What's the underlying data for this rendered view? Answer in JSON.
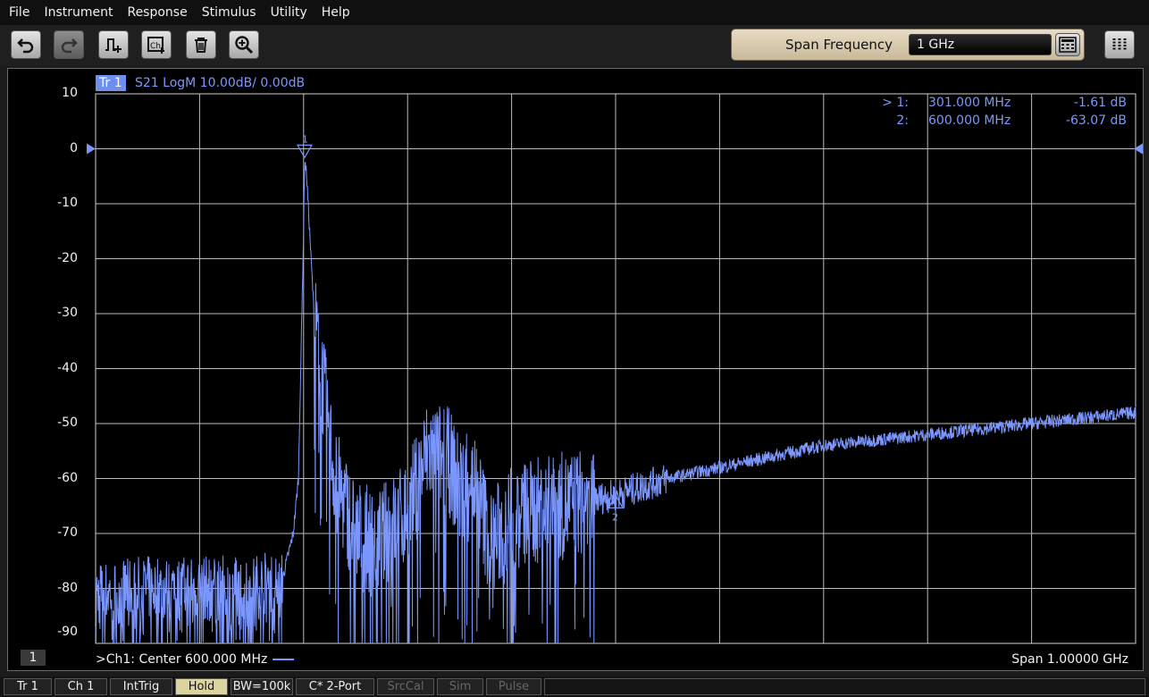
{
  "menu": [
    "File",
    "Instrument",
    "Response",
    "Stimulus",
    "Utility",
    "Help"
  ],
  "toolbar": {
    "icons": [
      "undo-icon",
      "redo-icon",
      "marker-add-icon",
      "channel-icon",
      "trash-icon",
      "zoom-in-icon"
    ],
    "ch_icon_text": "Ch",
    "span_label": "Span Frequency",
    "span_value": "1 GHz"
  },
  "trace": {
    "tag": "Tr 1",
    "info": "S21 LogM 10.00dB/  0.00dB",
    "color": "#7b97ff"
  },
  "markers": [
    {
      "label": "> 1:",
      "freq": "301.000  MHz",
      "value": "-1.61 dB",
      "id": "1"
    },
    {
      "label": "2:",
      "freq": "600.000  MHz",
      "value": "-63.07 dB",
      "id": "2"
    }
  ],
  "channel": {
    "indicator": "1",
    "center": ">Ch1:  Center  600.000 MHz",
    "span": "Span  1.00000 GHz"
  },
  "status": [
    "Tr 1",
    "Ch 1",
    "IntTrig",
    "Hold",
    "BW=100k",
    "C* 2-Port",
    "SrcCal",
    "Sim",
    "Pulse"
  ],
  "chart_data": {
    "type": "line",
    "title": "",
    "xlabel": "",
    "ylabel": "",
    "xlim": [
      100,
      1100
    ],
    "ylim": [
      -92,
      10
    ],
    "yticks": [
      10,
      0,
      -10,
      -20,
      -30,
      -40,
      -50,
      -60,
      -70,
      -80,
      -90
    ],
    "reference_level": 0,
    "grid": true,
    "series": [
      {
        "x": [
          100,
          150,
          200,
          250,
          280,
          290,
          295,
          300,
          301,
          303,
          310,
          320,
          330,
          350,
          370,
          400,
          420,
          440,
          450,
          460,
          480,
          500,
          520,
          550,
          600,
          650,
          700,
          750,
          800,
          850,
          900,
          950,
          1000,
          1050,
          1100
        ],
        "y": [
          -81,
          -80,
          -80,
          -80,
          -78,
          -70,
          -60,
          -15,
          -1.6,
          -5,
          -30,
          -45,
          -60,
          -70,
          -72,
          -66,
          -55,
          -57,
          -62,
          -58,
          -72,
          -67,
          -66,
          -65,
          -63,
          -60,
          -58,
          -56,
          -54,
          -53,
          -52,
          -51,
          -50,
          -49,
          -48
        ]
      }
    ]
  }
}
